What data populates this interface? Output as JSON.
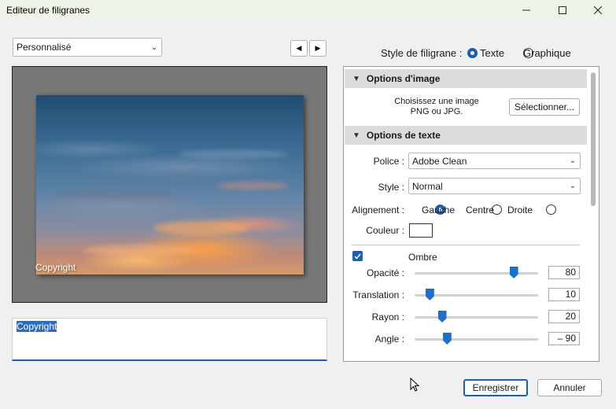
{
  "window": {
    "title": "Editeur de filigranes",
    "minimize_icon": "minimize-icon",
    "maximize_icon": "maximize-icon",
    "close_icon": "close-icon"
  },
  "preset": {
    "value": "Personnalisé"
  },
  "nav": {
    "prev_icon": "triangle-left-icon",
    "next_icon": "triangle-right-icon"
  },
  "preview": {
    "watermark_text": "Copyright"
  },
  "text_input": {
    "value": "Copyright"
  },
  "watermark_style": {
    "label": "Style de filigrane :",
    "options": [
      {
        "label": "Texte",
        "selected": true
      },
      {
        "label": "Graphique",
        "selected": false
      }
    ]
  },
  "image_options": {
    "header": "Options d'image",
    "prompt_line1": "Choisissez une image",
    "prompt_line2": "PNG ou JPG.",
    "select_button": "Sélectionner..."
  },
  "text_options": {
    "header": "Options de texte",
    "font_label": "Police :",
    "font_value": "Adobe Clean",
    "style_label": "Style :",
    "style_value": "Normal",
    "align_label": "Alignement :",
    "align_options": [
      {
        "label": "Gauche",
        "selected": true
      },
      {
        "label": "Centre",
        "selected": false
      },
      {
        "label": "Droite",
        "selected": false
      }
    ],
    "color_label": "Couleur :",
    "color_value": "#ffffff"
  },
  "shadow": {
    "label": "Ombre",
    "checked": true,
    "sliders": [
      {
        "label": "Opacité :",
        "value": "80",
        "fraction": 0.8
      },
      {
        "label": "Translation :",
        "value": "10",
        "fraction": 0.12
      },
      {
        "label": "Rayon :",
        "value": "20",
        "fraction": 0.22
      },
      {
        "label": "Angle :",
        "value": "– 90",
        "fraction": 0.26
      }
    ]
  },
  "footer": {
    "save": "Enregistrer",
    "cancel": "Annuler"
  },
  "colors": {
    "accent": "#1a5fb4",
    "selection": "#2b6cc4"
  }
}
